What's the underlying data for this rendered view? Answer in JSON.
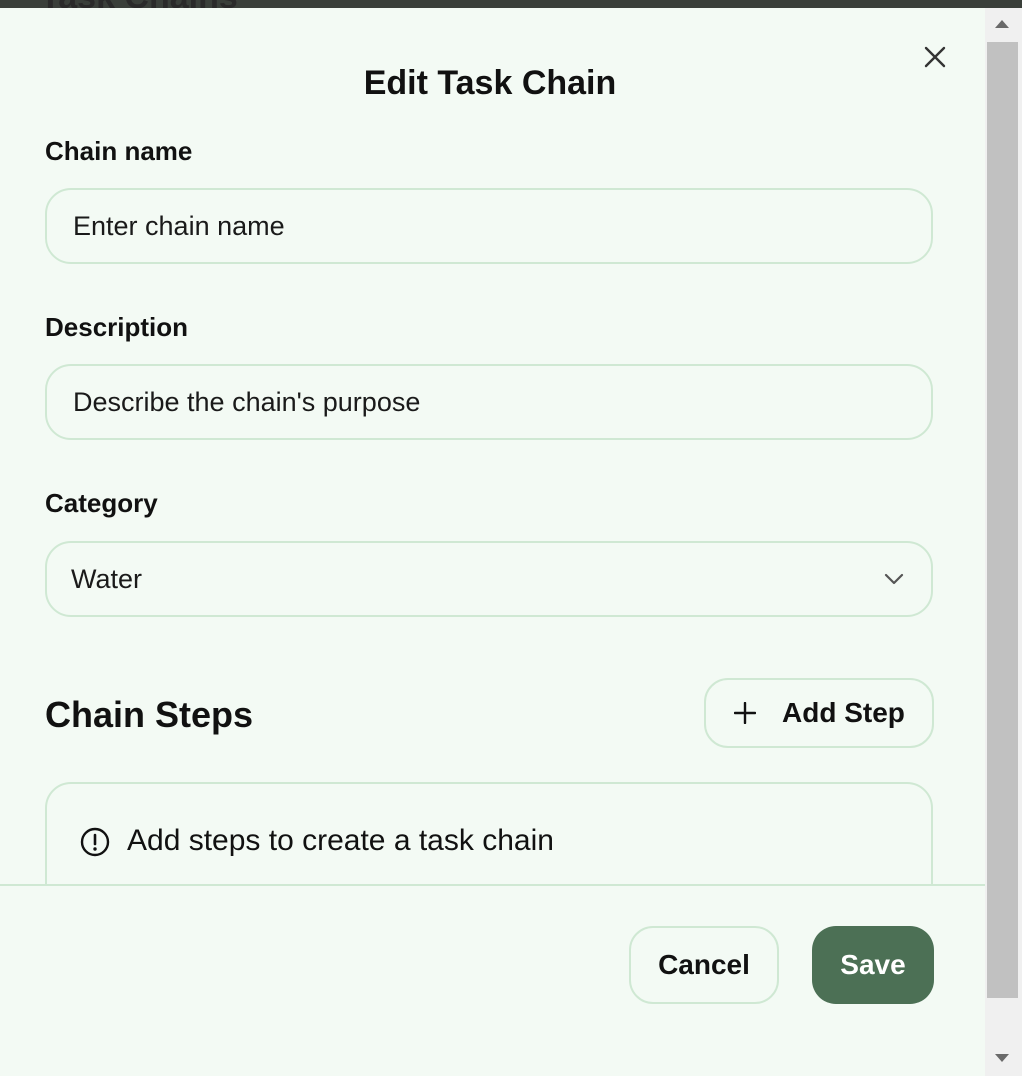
{
  "background": {
    "title": "Task Chains"
  },
  "modal": {
    "title": "Edit Task Chain",
    "close_icon": "close-icon"
  },
  "form": {
    "chain_name": {
      "label": "Chain name",
      "placeholder": "Enter chain name",
      "value": ""
    },
    "description": {
      "label": "Description",
      "placeholder": "Describe the chain's purpose",
      "value": ""
    },
    "category": {
      "label": "Category",
      "value": "Water",
      "icon": "chevron-down-icon"
    }
  },
  "steps": {
    "title": "Chain Steps",
    "add_button": "Add Step",
    "empty_message": "Add steps to create a task chain"
  },
  "footer": {
    "cancel_label": "Cancel",
    "save_label": "Save"
  },
  "colors": {
    "modal_bg": "#f3faf4",
    "border": "#cfe8d3",
    "primary": "#4c7055",
    "primary_text": "#ffffff"
  }
}
